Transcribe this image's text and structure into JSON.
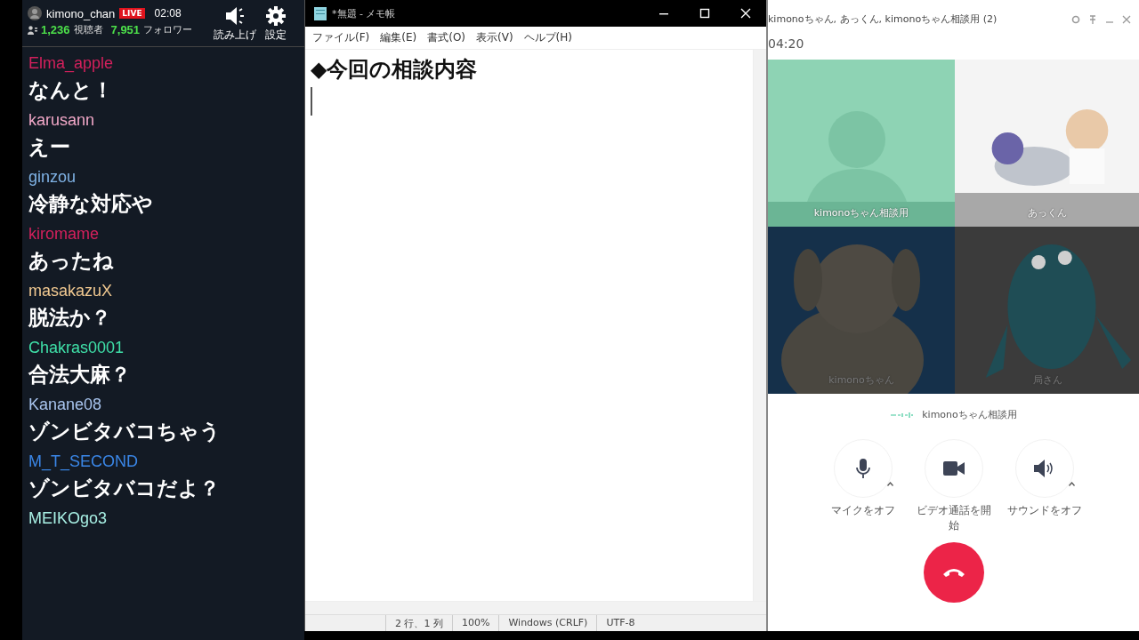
{
  "stream": {
    "channel": "kimono_chan",
    "live_badge": "LIVE",
    "elapsed": "02:08",
    "viewers": "1,236",
    "viewers_label": "視聴者",
    "followers": "7,951",
    "followers_label": "フォロワー",
    "tools": [
      {
        "kind": "speaker",
        "label": "読み上げ"
      },
      {
        "kind": "gear",
        "label": "設定"
      }
    ]
  },
  "chat": {
    "messages": [
      {
        "user": "Elma_apple",
        "color": "#d4205c",
        "text": "なんと！"
      },
      {
        "user": "karusann",
        "color": "#f2a8c8",
        "text": "えー"
      },
      {
        "user": "ginzou",
        "color": "#7fb2e5",
        "text": "冷静な対応や"
      },
      {
        "user": "kiromame",
        "color": "#d4205c",
        "text": "あったね"
      },
      {
        "user": "masakazuX",
        "color": "#f0c890",
        "text": "脱法か？"
      },
      {
        "user": "Chakras0001",
        "color": "#3fe0a8",
        "text": "合法大麻？"
      },
      {
        "user": "Kanane08",
        "color": "#a8c4ee",
        "text": "ゾンビタバコちゃう"
      },
      {
        "user": "M_T_SECOND",
        "color": "#3a86e6",
        "text": "ゾンビタバコだよ？"
      },
      {
        "user": "MEIKOgo3",
        "color": "#a8f0e4"
      }
    ]
  },
  "notepad": {
    "title": "*無題 - メモ帳",
    "menu": [
      "ファイル(F)",
      "編集(E)",
      "書式(O)",
      "表示(V)",
      "ヘルプ(H)"
    ],
    "content": "◆今回の相談内容",
    "status": [
      "2 行、1 列",
      "100%",
      "Windows (CRLF)",
      "UTF-8"
    ]
  },
  "call": {
    "title": "kimonoちゃん, あっくん, kimonoちゃん相談用  (2)",
    "time": "04:20",
    "tiles": [
      {
        "label": "kimonoちゃん相談用",
        "kind": "avatar"
      },
      {
        "label": "あっくん",
        "kind": "picture"
      },
      {
        "label": "kimonoちゃん",
        "kind": "picture"
      },
      {
        "label": "局さん",
        "kind": "picture"
      }
    ],
    "speaker": "kimonoちゃん相談用",
    "controls": [
      {
        "kind": "mic",
        "label": "マイクをオフ",
        "menu": true
      },
      {
        "kind": "video",
        "label": "ビデオ通話を開始",
        "menu": false
      },
      {
        "kind": "sound",
        "label": "サウンドをオフ",
        "menu": true
      }
    ]
  }
}
